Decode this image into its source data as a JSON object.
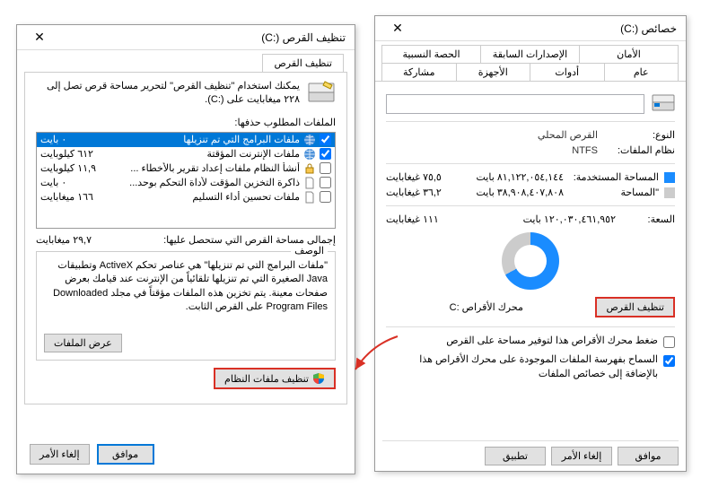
{
  "right": {
    "title": "خصائص (:C)",
    "tabs_row1": [
      "الأمان",
      "الإصدارات السابقة",
      "الحصة النسبية"
    ],
    "tabs_row2": [
      "عام",
      "أدوات",
      "الأجهزة",
      "مشاركة"
    ],
    "drive_value": "",
    "type_label": "النوع:",
    "type_value": "القرص المحلي",
    "fs_label": "نظام الملفات:",
    "fs_value": "NTFS",
    "used_label": "المساحة المستخدمة:",
    "used_bytes": "٨١,١٢٢,٠٥٤,١٤٤ بايت",
    "used_gb": "٧٥,٥ غيغابايت",
    "free_label": "\"المساحة",
    "free_bytes": "٣٨,٩٠٨,٤٠٧,٨٠٨ بايت",
    "free_gb": "٣٦,٢ غيغابايت",
    "capacity_label": "السعة:",
    "capacity_bytes": "١٢٠,٠٣٠,٤٦١,٩٥٢ بايت",
    "capacity_gb": "١١١ غيغابايت",
    "drive_c_label": "محرك الأقراص :C",
    "cleanup_btn": "تنظيف القرص",
    "compress_check": "ضغط محرك الأقراص هذا لتوفير مساحة على القرص",
    "index_check": "السماح بفهرسة الملفات الموجودة على محرك الأقراص هذا بالإضافة إلى خصائص الملفات",
    "ok": "موافق",
    "cancel": "إلغاء الأمر",
    "apply": "تطبيق"
  },
  "left": {
    "title": "تنظيف القرص (:C)",
    "tab": "تنظيف القرص",
    "intro": "يمكنك استخدام \"تنظيف القرص\" لتحرير مساحة قرص تصل إلى ٢٢٨ ميغابايت على (:C).",
    "files_label": "الملفات المطلوب حذفها:",
    "files": [
      {
        "name": "ملفات البرامج التي تم تنزيلها",
        "size": "٠ بايت",
        "checked": true,
        "selected": true,
        "icon": "globe"
      },
      {
        "name": "ملفات الإنترنت المؤقتة",
        "size": "٦١٢ كيلوبايت",
        "checked": true,
        "selected": false,
        "icon": "globe"
      },
      {
        "name": "أنشأ النظام ملفات إعداد تقرير بالأخطاء ...",
        "size": "١١,٩ كيلوبايت",
        "checked": false,
        "selected": false,
        "icon": "lock"
      },
      {
        "name": "ذاكرة التخزين المؤقت لأداة التحكم بوحد...",
        "size": "٠ بايت",
        "checked": false,
        "selected": false,
        "icon": "file"
      },
      {
        "name": "ملفات تحسين أداء التسليم",
        "size": "١٦٦ ميغابايت",
        "checked": false,
        "selected": false,
        "icon": "file"
      }
    ],
    "total_label": "إجمالي مساحة القرص التي ستحصل عليها:",
    "total_value": "٢٩,٧ ميغابايت",
    "desc_title": "الوصف",
    "desc_body": "\"ملفات البرامج التي تم تنزيلها\" هي عناصر تحكم ActiveX وتطبيقات Java الصغيرة التي تم تنزيلها تلقائياً من الإنترنت عند قيامك بعرض صفحات معينة. يتم تخزين هذه الملفات مؤقتاً في مجلد Downloaded Program Files على القرص الثابت.",
    "sysfiles_btn": "تنظيف ملفات النظام",
    "viewfiles_btn": "عرض الملفات",
    "ok": "موافق",
    "cancel": "إلغاء الأمر"
  }
}
